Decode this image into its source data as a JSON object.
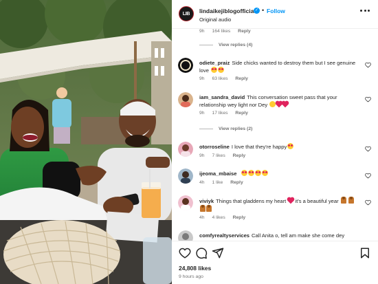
{
  "post": {
    "owner": "lindaikejiblogofficial",
    "owner_logo": "LIB",
    "follow_label": "Follow",
    "dot": "•",
    "audio": "Original audio",
    "verified_glyph": "✓"
  },
  "top_meta": {
    "time": "9h",
    "likes": "164 likes",
    "reply": "Reply"
  },
  "view_replies_1": "View replies (4)",
  "view_replies_2": "View replies (2)",
  "comments": [
    {
      "user": "odiete_praiz",
      "text": "Side chicks wanted to destroy them but I see genuine love",
      "time": "9h",
      "likes": "63 likes",
      "reply": "Reply"
    },
    {
      "user": "iam_sandra_david",
      "text": "This conversation sweet pass that your relationship wey light nor Dey",
      "time": "9h",
      "likes": "17 likes",
      "reply": "Reply"
    },
    {
      "user": "otorroseline",
      "text": "I love that they're happy",
      "time": "9h",
      "likes": "7 likes",
      "reply": "Reply"
    },
    {
      "user": "ijeoma_mbaise",
      "text": "",
      "time": "4h",
      "likes": "1 like",
      "reply": "Reply"
    },
    {
      "user": "viviyk",
      "text": "Things that gladdens my heart",
      "text2": "it's a beautiful year",
      "time": "4h",
      "likes": "4 likes",
      "reply": "Reply"
    },
    {
      "user": "comfyrealtyservices",
      "text": "Call Anita o, tell am make she come dey"
    }
  ],
  "likes_count": "24,808 likes",
  "posted_ago": "9 hours ago",
  "colors": {
    "accent": "#0095f6",
    "brand": "#b3202a",
    "text": "#262626",
    "muted": "#737373"
  },
  "icons": [
    "heart-icon",
    "comment-icon",
    "share-icon",
    "bookmark-icon",
    "more-icon",
    "verified-icon"
  ]
}
